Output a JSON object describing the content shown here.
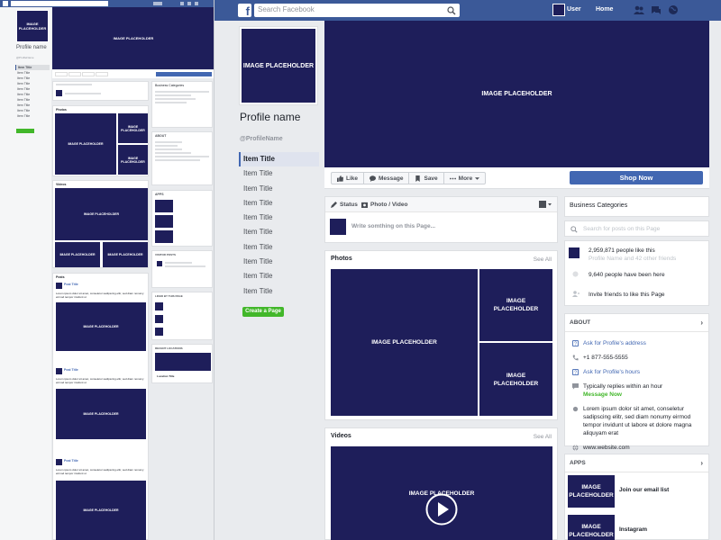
{
  "topbar": {
    "logo": "f",
    "search_placeholder": "Search Facebook",
    "user_label": "User",
    "home_label": "Home"
  },
  "profile": {
    "picture_text": "IMAGE PLACEHOLDER",
    "name": "Profile name",
    "handle": "@ProfileName"
  },
  "nav": {
    "items": [
      "Item Title",
      "Item Title",
      "Item Title",
      "Item Title",
      "Item Title",
      "Item Title",
      "Item Title",
      "Item Title",
      "Item Title",
      "Item Title"
    ],
    "create_page": "Create a Page"
  },
  "cover": {
    "text": "IMAGE PLACEHOLDER"
  },
  "actions": {
    "like": "Like",
    "message": "Message",
    "save": "Save",
    "more": "More",
    "shop_now": "Shop Now"
  },
  "composer": {
    "status": "Status",
    "photo_video": "Photo / Video",
    "placeholder": "Write somthing on this Page..."
  },
  "photos": {
    "title": "Photos",
    "see_all": "See All",
    "placeholder": "IMAGE PLACEHOLDER"
  },
  "videos": {
    "title": "Videos",
    "see_all": "See All",
    "placeholder": "IMAGE PLACEHOLDER"
  },
  "right": {
    "business_categories": "Business Categories",
    "search_placeholder": "Search for posts on this Page",
    "likes_count": "2,959,871 people like this",
    "likes_friends": "Profile Name and 42 other friends",
    "been_here": "9,640 people have been here",
    "invite": "Invite friends to like this Page",
    "about_title": "ABOUT",
    "ask_address": "Ask for Profile's address",
    "phone": "+1 877-555-5555",
    "ask_hours": "Ask for Profile's hours",
    "replies": "Typically replies within an hour",
    "message_now": "Message Now",
    "lorem": "Lorem ipsum dolor sit amet, conseletur sadipscing elitr, sed diam nonumy eirmod tempor invidunt ut labore et dolore magna aliquyam erat",
    "website": "www.website.com",
    "apps_title": "APPS",
    "apps": [
      {
        "image": "IMAGE PLACEHOLDER",
        "label": "Join our email list"
      },
      {
        "image": "IMAGE PLACEHOLDER",
        "label": "Instagram"
      }
    ]
  },
  "thumbnail": {
    "profile_name": "Profile name",
    "photos_title": "Photos",
    "videos_title": "Videos",
    "posts_title": "Posts",
    "post_title": "Post Title",
    "lorem_short": "Lorem ipsum dolor sit amet, conseletur sadipscing elitr, sed diam nonumy eirmod tempor invidunt ut",
    "image_text": "IMAGE PLACEHOLDER",
    "business_categories": "Business Categories",
    "about": "ABOUT",
    "apps": "APPS",
    "visitor_posts": "VISITOR POSTS",
    "liked_by": "LIKED BY THIS PAGE",
    "recent_locations": "RECENT LOCATIONS",
    "location_title": "Location Title",
    "profile_item": "Profile Name",
    "shop_now": "Shop Now"
  },
  "colors": {
    "brand_blue": "#3b5998",
    "button_blue": "#4267b2",
    "placeholder_navy": "#1e1e5a",
    "green": "#42b72a",
    "page_bg": "#e9ebee"
  }
}
